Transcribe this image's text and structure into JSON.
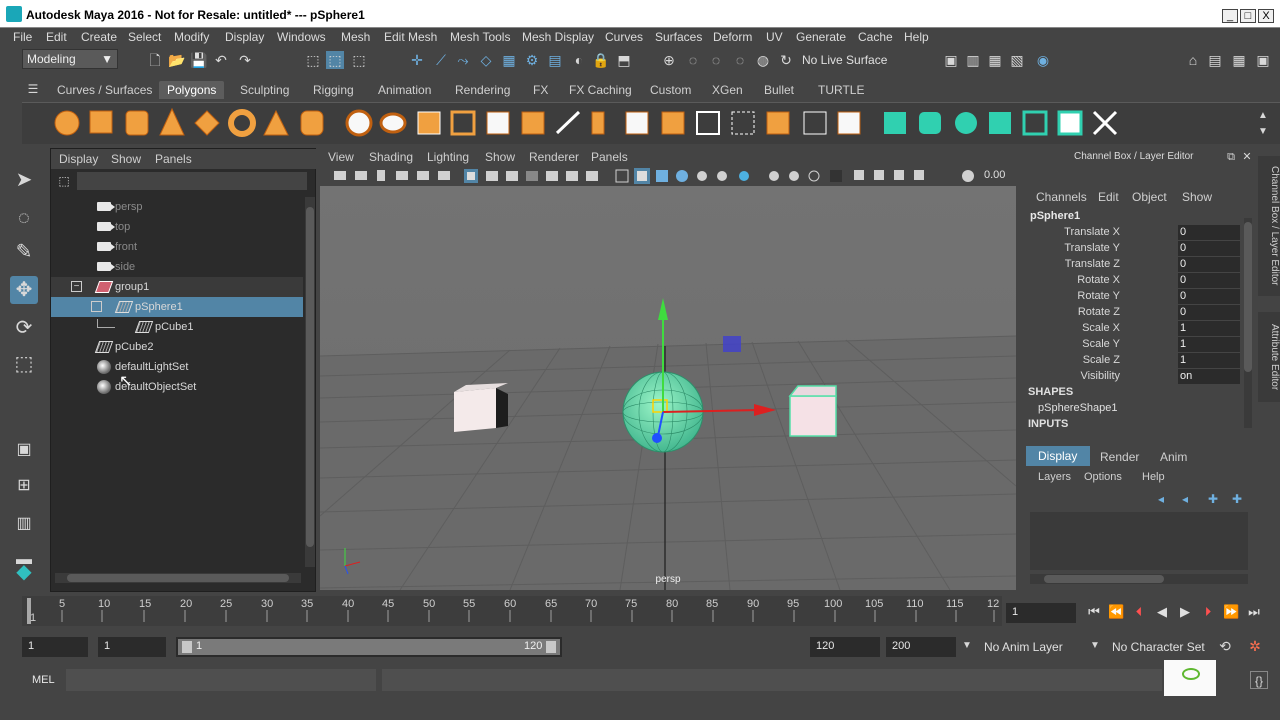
{
  "window": {
    "title": "Autodesk Maya 2016 - Not for Resale: untitled*   ---   pSphere1",
    "buttons": [
      "_",
      "□",
      "X"
    ]
  },
  "menubar": [
    "File",
    "Edit",
    "Create",
    "Select",
    "Modify",
    "Display",
    "Windows",
    "Mesh",
    "Edit Mesh",
    "Mesh Tools",
    "Mesh Display",
    "Curves",
    "Surfaces",
    "Deform",
    "UV",
    "Generate",
    "Cache",
    "Help"
  ],
  "status": {
    "menuset": "Modeling",
    "live_surface": "No Live Surface"
  },
  "shelf_tabs": [
    "Curves / Surfaces",
    "Polygons",
    "Sculpting",
    "Rigging",
    "Animation",
    "Rendering",
    "FX",
    "FX Caching",
    "Custom",
    "XGen",
    "Bullet",
    "TURTLE"
  ],
  "shelf_active": "Polygons",
  "outliner": {
    "menu": [
      "Display",
      "Show",
      "Panels"
    ],
    "items": [
      {
        "label": "persp",
        "icon": "camera-icon"
      },
      {
        "label": "top",
        "icon": "camera-icon"
      },
      {
        "label": "front",
        "icon": "camera-icon"
      },
      {
        "label": "side",
        "icon": "camera-icon"
      },
      {
        "label": "group1",
        "icon": "group-icon"
      },
      {
        "label": "pSphere1",
        "icon": "mesh-icon"
      },
      {
        "label": "pCube1",
        "icon": "mesh-icon"
      },
      {
        "label": "pCube2",
        "icon": "mesh-icon"
      },
      {
        "label": "defaultLightSet",
        "icon": "set-icon"
      },
      {
        "label": "defaultObjectSet",
        "icon": "set-icon"
      }
    ]
  },
  "viewport": {
    "menu": [
      "View",
      "Shading",
      "Lighting",
      "Show",
      "Renderer",
      "Panels"
    ],
    "camera_label": "persp",
    "value_readout": "0.00"
  },
  "channel_box": {
    "title": "Channel Box / Layer Editor",
    "menu": [
      "Channels",
      "Edit",
      "Object",
      "Show"
    ],
    "object": "pSphere1",
    "channels": [
      {
        "name": "Translate X",
        "value": "0"
      },
      {
        "name": "Translate Y",
        "value": "0"
      },
      {
        "name": "Translate Z",
        "value": "0"
      },
      {
        "name": "Rotate X",
        "value": "0"
      },
      {
        "name": "Rotate Y",
        "value": "0"
      },
      {
        "name": "Rotate Z",
        "value": "0"
      },
      {
        "name": "Scale X",
        "value": "1"
      },
      {
        "name": "Scale Y",
        "value": "1"
      },
      {
        "name": "Scale Z",
        "value": "1"
      },
      {
        "name": "Visibility",
        "value": "on"
      }
    ],
    "shapes_label": "SHAPES",
    "shape_name": "pSphereShape1",
    "inputs_label": "INPUTS",
    "layer_tabs": [
      "Display",
      "Render",
      "Anim"
    ],
    "layer_menu": [
      "Layers",
      "Options",
      "Help"
    ],
    "side_tabs": [
      "Channel Box / Layer Editor",
      "Attribute Editor"
    ]
  },
  "timeline": {
    "ticks": [
      "1",
      "5",
      "10",
      "15",
      "20",
      "25",
      "30",
      "35",
      "40",
      "45",
      "50",
      "55",
      "60",
      "65",
      "70",
      "75",
      "80",
      "85",
      "90",
      "95",
      "100",
      "105",
      "110",
      "115",
      "12"
    ],
    "current_frame": "1"
  },
  "range": {
    "start": "1",
    "playback_start": "1",
    "slider_start": "1",
    "slider_end": "120",
    "playback_end": "120",
    "end": "200",
    "anim_layer": "No Anim Layer",
    "character_set": "No Character Set"
  },
  "command_line": {
    "label": "MEL"
  }
}
